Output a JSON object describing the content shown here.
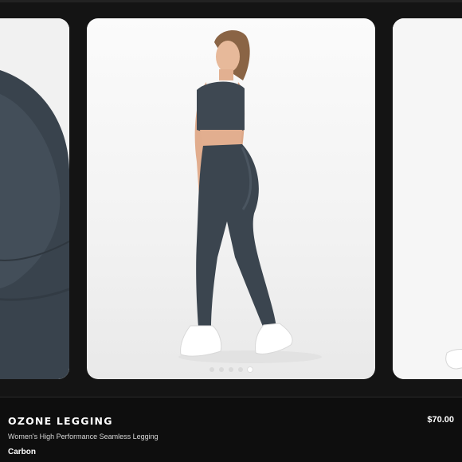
{
  "product": {
    "name": "OZONE LEGGING",
    "price": "$70.00",
    "subtitle": "Women's High Performance Seamless Legging",
    "colour": "Carbon"
  },
  "gallery": {
    "slide_count": 5,
    "active_slide": 5,
    "image_subject": "legging-model-photo"
  },
  "colors": {
    "background": "#141414",
    "info_panel": "#0e0e0e",
    "garment": "#3b454f"
  }
}
